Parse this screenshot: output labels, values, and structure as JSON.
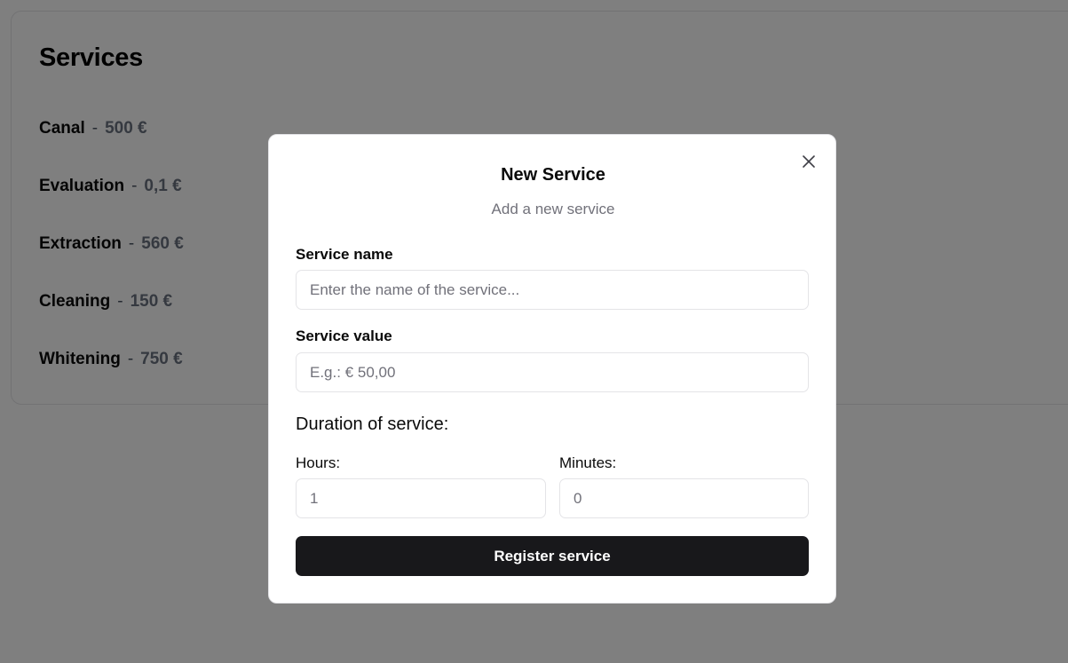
{
  "services_panel": {
    "title": "Services",
    "separator": "-",
    "items": [
      {
        "name": "Canal",
        "price": "500 €"
      },
      {
        "name": "Evaluation",
        "price": "0,1 €"
      },
      {
        "name": "Extraction",
        "price": "560 €"
      },
      {
        "name": "Cleaning",
        "price": "150 €"
      },
      {
        "name": "Whitening",
        "price": "750 €"
      }
    ]
  },
  "modal": {
    "title": "New Service",
    "subtitle": "Add a new service",
    "close_icon": "close-icon",
    "service_name": {
      "label": "Service name",
      "placeholder": "Enter the name of the service...",
      "value": ""
    },
    "service_value": {
      "label": "Service value",
      "placeholder": "E.g.: € 50,00",
      "value": ""
    },
    "duration_heading": "Duration of service:",
    "hours": {
      "label": "Hours:",
      "placeholder": "1",
      "value": ""
    },
    "minutes": {
      "label": "Minutes:",
      "placeholder": "0",
      "value": ""
    },
    "submit_label": "Register service"
  },
  "colors": {
    "overlay": "rgba(0,0,0,0.5)",
    "button_bg": "#18181b",
    "muted_text": "#71717a",
    "border": "#e4e4e7"
  }
}
